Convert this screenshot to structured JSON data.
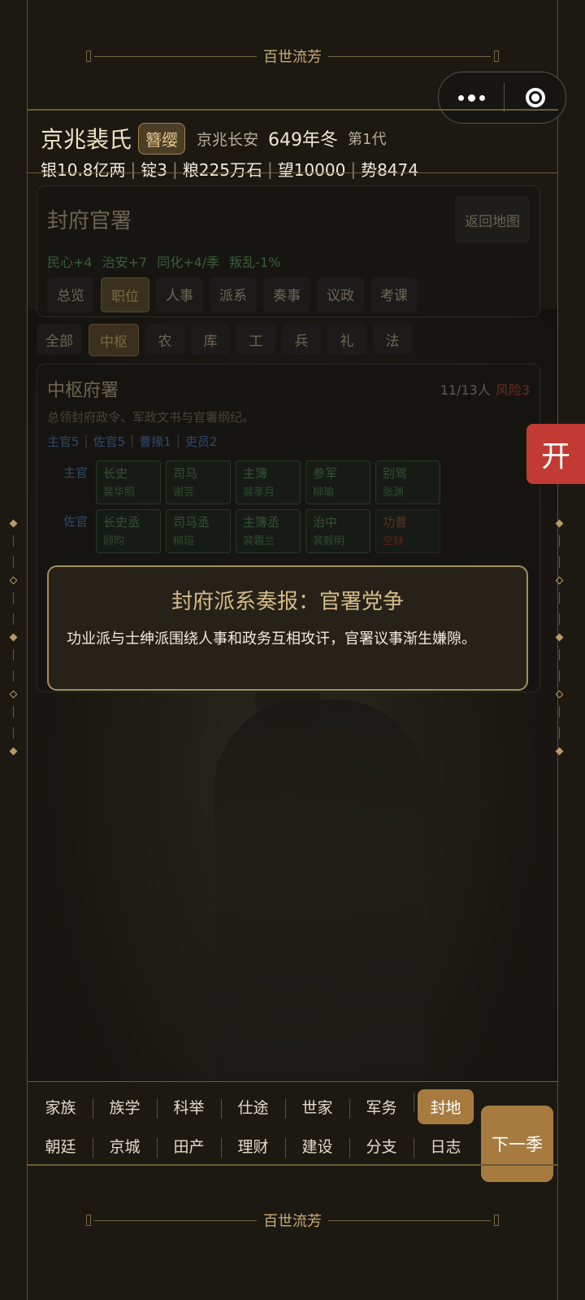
{
  "ornament": {
    "title": "百世流芳"
  },
  "capsule": {
    "more_icon": "more-dots-icon",
    "close_icon": "target-icon"
  },
  "house": {
    "name": "京兆裴氏",
    "badge": "簪缨",
    "location": "京兆长安",
    "year": "649年冬",
    "generation": "第1代"
  },
  "stats": {
    "silver": "银10.8亿两",
    "ingot": "锭3",
    "grain": "粮225万石",
    "prestige": "望10000",
    "power": "势8474"
  },
  "office_panel": {
    "title": "封府官署",
    "back_button": "返回地图",
    "effects": [
      "民心+4",
      "治安+7",
      "同化+4/季",
      "叛乱-1%"
    ],
    "tabs": [
      "总览",
      "职位",
      "人事",
      "派系",
      "奏事",
      "议政",
      "考课"
    ],
    "active_tab": "职位"
  },
  "category_tabs": {
    "items": [
      "全部",
      "中枢",
      "农",
      "库",
      "工",
      "兵",
      "礼",
      "法"
    ],
    "active": "中枢"
  },
  "central_office": {
    "title": "中枢府署",
    "count": "11/13人",
    "risk": "风险3",
    "description": "总领封府政令、军政文书与官署纲纪。",
    "summary": [
      "主官5",
      "佐官5",
      "曹掾1",
      "吏员2"
    ],
    "rows": [
      {
        "label": "主官",
        "slots": [
          {
            "role": "长史",
            "name": "裴华照"
          },
          {
            "role": "司马",
            "name": "谢芸"
          },
          {
            "role": "主簿",
            "name": "裴孝月"
          },
          {
            "role": "参军",
            "name": "柳瑜"
          },
          {
            "role": "别驾",
            "name": "张渊"
          }
        ]
      },
      {
        "label": "佐官",
        "slots": [
          {
            "role": "长史丞",
            "name": "顾昀"
          },
          {
            "role": "司马丞",
            "name": "柳瑄"
          },
          {
            "role": "主簿丞",
            "name": "裴霜兰"
          },
          {
            "role": "治中",
            "name": "裴毅明"
          },
          {
            "role": "功曹",
            "name": "空缺"
          }
        ]
      }
    ]
  },
  "modal": {
    "title": "封府派系奏报：官署党争",
    "body": "功业派与士绅派围绕人事和政务互相攻讦，官署议事渐生嫌隙。"
  },
  "side_button": "开",
  "nav": {
    "row1": [
      "家族",
      "族学",
      "科举",
      "仕途",
      "世家",
      "军务",
      "封地"
    ],
    "row2": [
      "朝廷",
      "京城",
      "田产",
      "理财",
      "建设",
      "分支",
      "日志"
    ],
    "active": "封地",
    "next": "下一季"
  },
  "colors": {
    "accent": "#a77b3f",
    "danger": "#c23a33",
    "gold_border": "#a58d5f"
  }
}
